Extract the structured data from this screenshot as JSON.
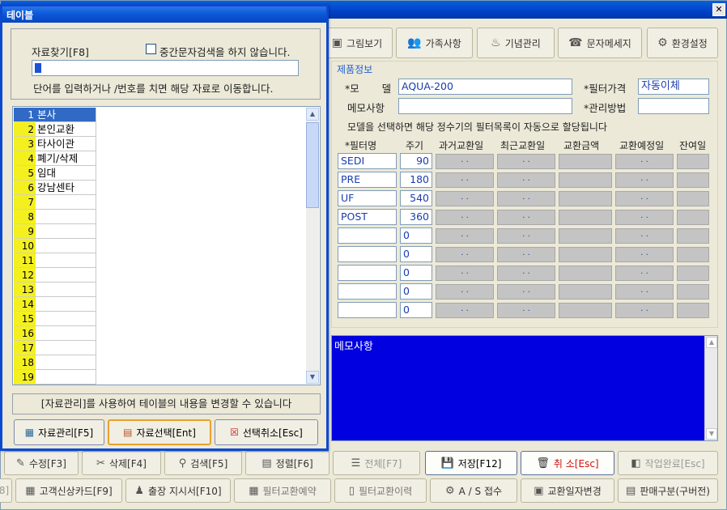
{
  "main": {
    "toolbar": [
      {
        "label": "그림보기",
        "icon": "picture-icon"
      },
      {
        "label": "가족사항",
        "icon": "family-icon"
      },
      {
        "label": "기념관리",
        "icon": "gift-icon"
      },
      {
        "label": "문자메세지",
        "icon": "phone-icon"
      },
      {
        "label": "환경설정",
        "icon": "tools-icon"
      }
    ],
    "product_info": {
      "title": "제품정보",
      "model_label": "*모       델",
      "model_value": "AQUA-200",
      "filter_price_label": "*필터가격",
      "filter_price_value": "자동이체",
      "memo_label": "메모사항",
      "memo_value": "",
      "manage_label": "*관리방법",
      "manage_value": "",
      "notice": "모델을 선택하면 해당 정수기의 필터목록이 자동으로 할당됩니다"
    },
    "filter_table": {
      "headers": [
        "*필터명",
        "주기",
        "과거교환일",
        "최근교환일",
        "교환금액",
        "교환예정일",
        "잔여일"
      ],
      "rows": [
        {
          "name": "SEDI",
          "cycle": "90"
        },
        {
          "name": "PRE",
          "cycle": "180"
        },
        {
          "name": "UF",
          "cycle": "540"
        },
        {
          "name": "POST",
          "cycle": "360"
        },
        {
          "name": "",
          "cycle": "0"
        },
        {
          "name": "",
          "cycle": "0"
        },
        {
          "name": "",
          "cycle": "0"
        },
        {
          "name": "",
          "cycle": "0"
        },
        {
          "name": "",
          "cycle": "0"
        }
      ],
      "date_placeholder": ".   ."
    },
    "memo_box": {
      "label": "메모사항"
    },
    "bottom_row1": [
      {
        "label": "수정[F3]",
        "icon": "edit-icon"
      },
      {
        "label": "삭제[F4]",
        "icon": "delete-icon"
      },
      {
        "label": "검색[F5]",
        "icon": "search-icon"
      },
      {
        "label": "정렬[F6]",
        "icon": "sort-icon"
      },
      {
        "label": "전체[F7]",
        "icon": "list-icon"
      },
      {
        "label": "저장[F12]",
        "icon": "save-icon"
      },
      {
        "label": "취 소[Esc]",
        "icon": "cancel-icon"
      },
      {
        "label": "작업완료[Esc]",
        "icon": "done-icon"
      }
    ],
    "bottom_row2": [
      {
        "label": "8]",
        "icon": ""
      },
      {
        "label": "고객신상카드[F9]",
        "icon": "card-icon"
      },
      {
        "label": "출장 지시서[F10]",
        "icon": "trip-icon"
      },
      {
        "label": "필터교환예약",
        "icon": "grid-icon"
      },
      {
        "label": "필터교환이력",
        "icon": "history-icon"
      },
      {
        "label": "A / S 접수",
        "icon": "service-icon"
      },
      {
        "label": "교환일자변경",
        "icon": "calendar-icon"
      },
      {
        "label": "판매구분(구버전)",
        "icon": "sales-icon"
      }
    ]
  },
  "dialog": {
    "title": "테이블",
    "search_label": "자료찾기[F8]",
    "checkbox_label": "중간문자검색을 하지 않습니다.",
    "search_value": "",
    "hint": "단어를 입력하거나  /번호를 치면 해당 자료로 이동합니다.",
    "rows": [
      {
        "no": "1",
        "name": "본사"
      },
      {
        "no": "2",
        "name": "본인교환"
      },
      {
        "no": "3",
        "name": "타사이관"
      },
      {
        "no": "4",
        "name": "폐기/삭제"
      },
      {
        "no": "5",
        "name": "임대"
      },
      {
        "no": "6",
        "name": "강남센타"
      },
      {
        "no": "7",
        "name": ""
      },
      {
        "no": "8",
        "name": ""
      },
      {
        "no": "9",
        "name": ""
      },
      {
        "no": "10",
        "name": ""
      },
      {
        "no": "11",
        "name": ""
      },
      {
        "no": "12",
        "name": ""
      },
      {
        "no": "13",
        "name": ""
      },
      {
        "no": "14",
        "name": ""
      },
      {
        "no": "15",
        "name": ""
      },
      {
        "no": "16",
        "name": ""
      },
      {
        "no": "17",
        "name": ""
      },
      {
        "no": "18",
        "name": ""
      },
      {
        "no": "19",
        "name": ""
      }
    ],
    "note": "[자료관리]를 사용하여 테이블의 내용을 변경할 수 있습니다",
    "buttons": [
      {
        "label": "자료관리[F5]",
        "icon": "table-icon"
      },
      {
        "label": "자료선택[Ent]",
        "icon": "select-icon"
      },
      {
        "label": "선택취소[Esc]",
        "icon": "checklist-cancel-icon"
      }
    ]
  },
  "colors": {
    "accent": "#0a4ad0",
    "selection": "#316ac5",
    "number_col": "#f4f020",
    "memo_bg": "#0000e0",
    "field_text": "#1a3cb0"
  }
}
